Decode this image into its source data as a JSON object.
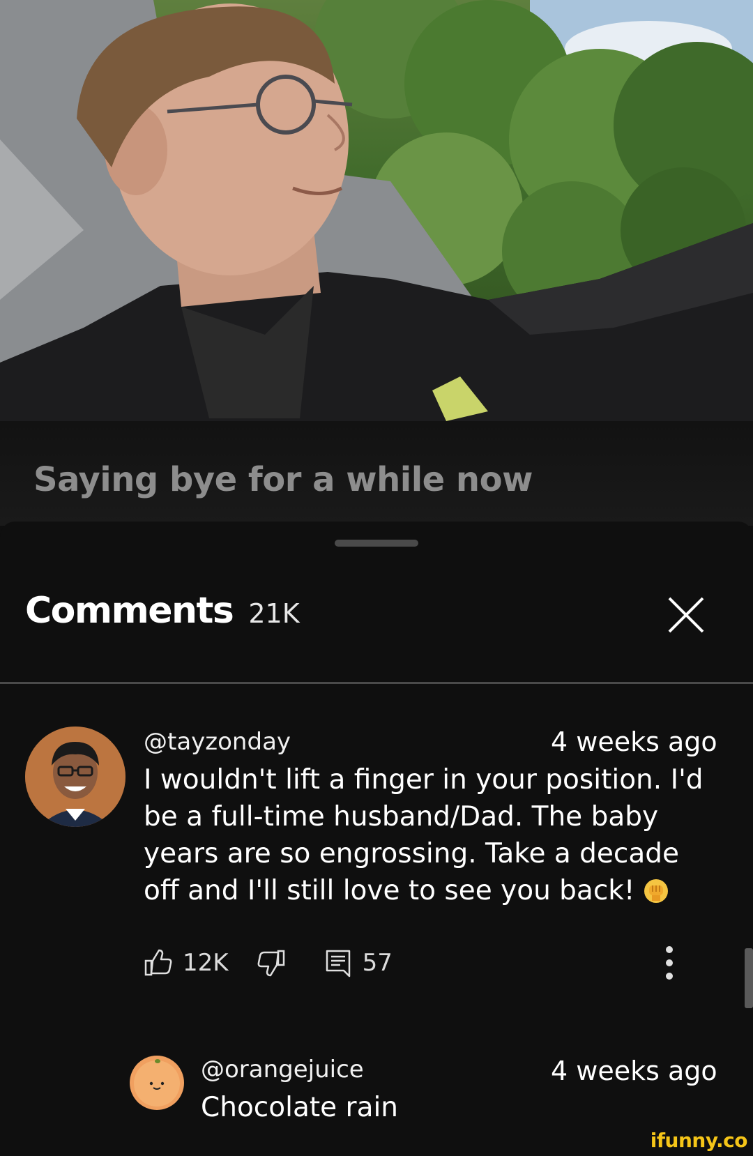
{
  "video": {
    "title": "Saying bye for a while now"
  },
  "comments_panel": {
    "title": "Comments",
    "count": "21K",
    "close_icon": "close-icon"
  },
  "comments": [
    {
      "author": "@tayzonday",
      "time": "4 weeks ago",
      "text": "I wouldn't lift a finger in your position. I'd be a full-time husband/Dad. The baby years are so engrossing. Take a decade off and I'll still love to see you back!",
      "emoji": "raised-fist-emoji",
      "likes": "12K",
      "replies": "57"
    },
    {
      "author": "@orangejuice",
      "time": "4 weeks ago",
      "text": "Chocolate rain"
    }
  ],
  "icons": {
    "like": "thumbs-up-icon",
    "dislike": "thumbs-down-icon",
    "reply": "comment-icon",
    "more": "more-vert-icon"
  },
  "watermark": "ifunny.co",
  "colors": {
    "background": "#0f0f0f",
    "watermark": "#f5c518"
  }
}
